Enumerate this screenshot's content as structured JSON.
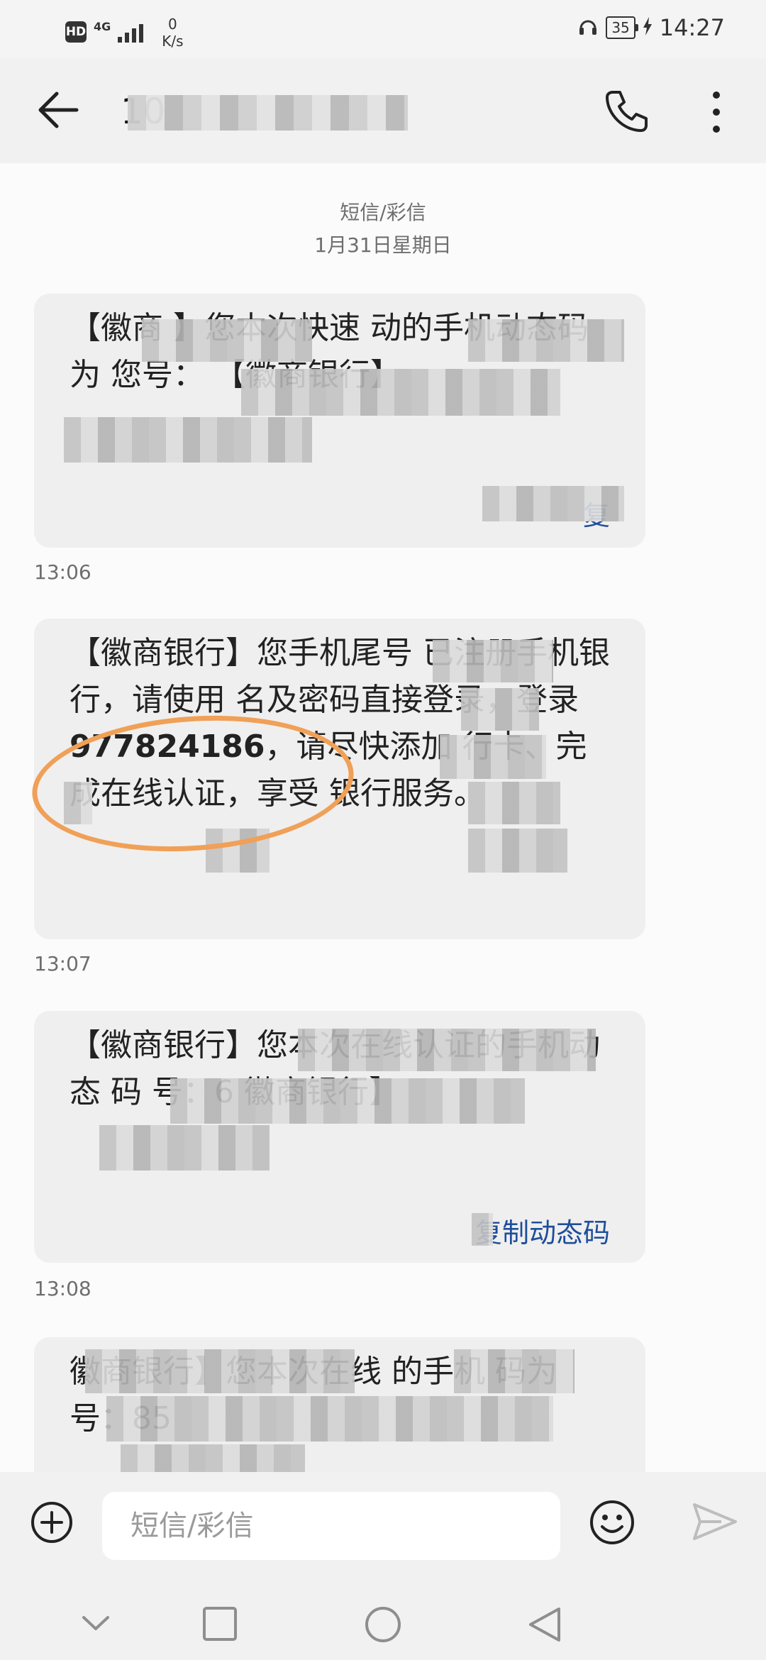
{
  "status": {
    "hd": "HD",
    "network": "4G",
    "speed_value": "0",
    "speed_unit": "K/s",
    "battery": "35",
    "time": "14:27"
  },
  "header": {
    "contact": "10"
  },
  "thread": {
    "label": "短信/彩信",
    "date": "1月31日星期日",
    "messages": [
      {
        "text": "【徽商    】您本次快速      动的手机动态码为                您号：  【徽商银行】",
        "action": "复",
        "time": "13:06"
      },
      {
        "pre": "【徽商银行】您手机尾号     已注册手机银行，请使用  名及密码直接登录，登录  ",
        "number": "977824186",
        "post": "，请尽快添加  行卡、完成在线认证，享受    银行服务。",
        "time": "13:07"
      },
      {
        "text": "【徽商银行】您本次在线认证的手机动态      码  号：6  徽商银行】",
        "action": "复制动态码",
        "time": "13:08"
      },
      {
        "text": "徽商银行】您本次在线     的手机     码为      号：85",
        "time": ""
      }
    ]
  },
  "composer": {
    "placeholder": "短信/彩信"
  }
}
